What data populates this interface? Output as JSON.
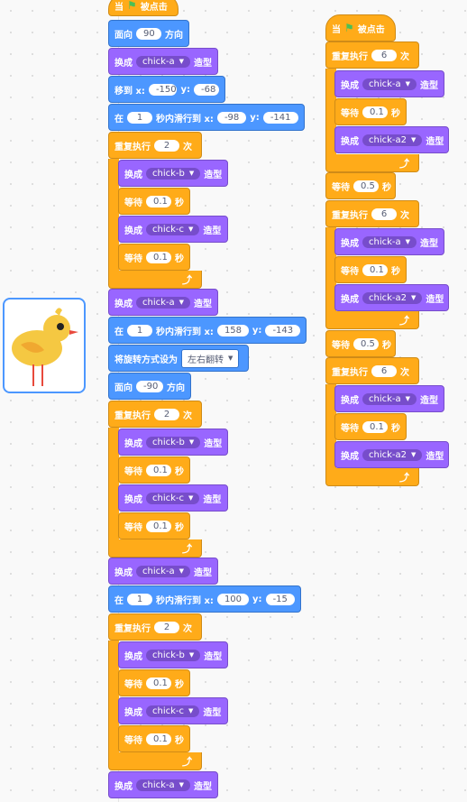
{
  "labels": {
    "when": "当",
    "clicked": "被点击",
    "point_dir": "面向",
    "direction": "方向",
    "switch_costume": "换成",
    "costume": "造型",
    "goto_x": "移到 x:",
    "y": "y:",
    "glide_in": "在",
    "glide_to": "秒内滑行到 x:",
    "repeat": "重复执行",
    "times": "次",
    "wait": "等待",
    "seconds": "秒",
    "rotation_style": "将旋转方式设为"
  },
  "script1": {
    "point1": "90",
    "costume1": "chick-a",
    "goto_x": "-150",
    "goto_y": "-68",
    "glide1_secs": "1",
    "glide1_x": "-98",
    "glide1_y": "-141",
    "rep1_count": "2",
    "rep1_c1": "chick-b",
    "rep1_w1": "0.1",
    "rep1_c2": "chick-c",
    "rep1_w2": "0.1",
    "costume2": "chick-a",
    "glide2_secs": "1",
    "glide2_x": "158",
    "glide2_y": "-143",
    "rotation": "左右翻转",
    "point2": "-90",
    "rep2_count": "2",
    "rep2_c1": "chick-b",
    "rep2_w1": "0.1",
    "rep2_c2": "chick-c",
    "rep2_w2": "0.1",
    "costume3": "chick-a",
    "glide3_secs": "1",
    "glide3_x": "100",
    "glide3_y": "-15",
    "rep3_count": "2",
    "rep3_c1": "chick-b",
    "rep3_w1": "0.1",
    "rep3_c2": "chick-c",
    "rep3_w2": "0.1",
    "costume4": "chick-a"
  },
  "script2": {
    "rep1_count": "6",
    "rep1_c1": "chick-a",
    "rep1_w": "0.1",
    "rep1_c2": "chick-a2",
    "wait1": "0.5",
    "rep2_count": "6",
    "rep2_c1": "chick-a",
    "rep2_w": "0.1",
    "rep2_c2": "chick-a2",
    "wait2": "0.5",
    "rep3_count": "6",
    "rep3_c1": "chick-a",
    "rep3_w": "0.1",
    "rep3_c2": "chick-a2"
  },
  "icons": {
    "flag": "green-flag-icon",
    "caret": "dropdown-caret-icon",
    "loop_arrow": "repeat-arrow-icon"
  },
  "colors": {
    "motion": "#4c97ff",
    "looks": "#9966ff",
    "control": "#ffab19",
    "events": "#ffbf00"
  }
}
